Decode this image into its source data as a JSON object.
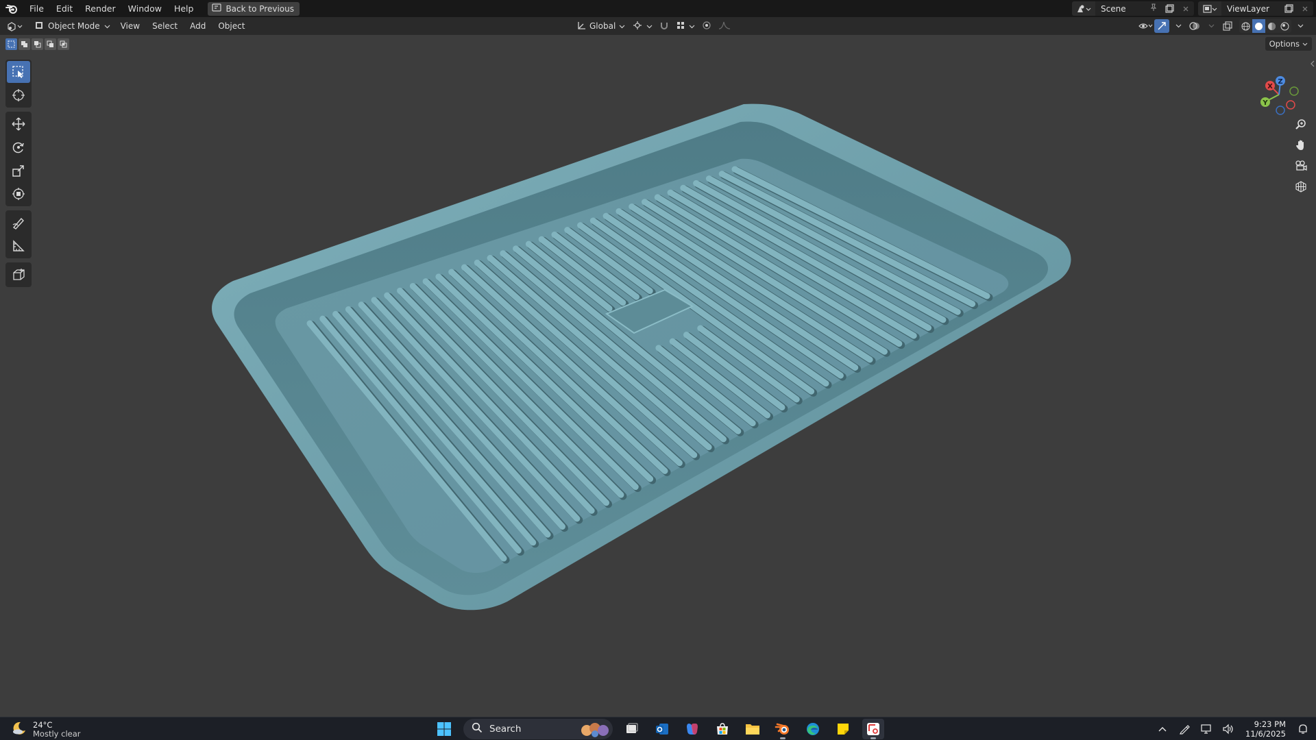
{
  "menubar": {
    "items": [
      "File",
      "Edit",
      "Render",
      "Window",
      "Help"
    ],
    "back_button": "Back to Previous",
    "scene_name": "Scene",
    "view_layer": "ViewLayer"
  },
  "viewport_header": {
    "mode": "Object Mode",
    "menus": [
      "View",
      "Select",
      "Add",
      "Object"
    ],
    "transform_orientation": "Global"
  },
  "viewport": {
    "options_label": "Options",
    "gizmo_axes": [
      "X",
      "Y",
      "Z"
    ],
    "toolbar_tools": [
      "select-box",
      "cursor",
      "move",
      "rotate",
      "scale",
      "transform",
      "annotate",
      "measure",
      "add-cube"
    ],
    "active_tool": "select-box",
    "object_color": "#6a98a4"
  },
  "taskbar": {
    "weather_temp": "24°C",
    "weather_desc": "Mostly clear",
    "search_label": "Search",
    "time": "9:23 PM",
    "date": "11/6/2025",
    "apps": [
      "file-explorer-icon",
      "outlook-icon",
      "copilot-icon",
      "store-icon",
      "folder-icon",
      "blender-icon",
      "edge-icon",
      "sticky-notes-icon",
      "snipping-tool-icon"
    ]
  },
  "colors": {
    "accent": "#4772b3",
    "topbar_bg": "#181818",
    "viewport_bg": "#3d3d3d",
    "axis_x": "#e34a4a",
    "axis_y": "#8bc34a",
    "axis_z": "#4d8be0"
  }
}
